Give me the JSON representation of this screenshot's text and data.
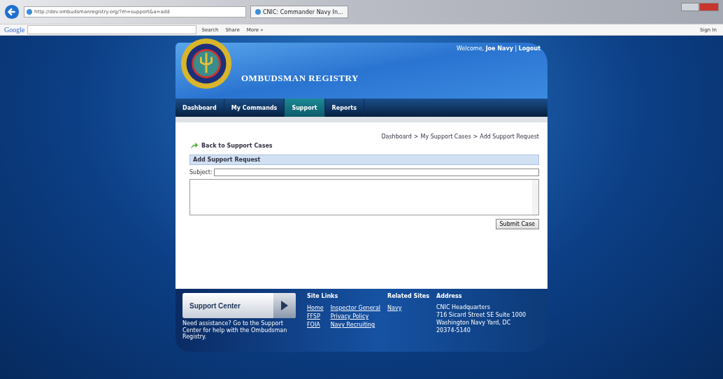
{
  "browser": {
    "url": "http://dev.ombudsmanregistry.org/?m=support&a=add",
    "tab_title": "CNIC: Commander Navy In...",
    "toolbar": {
      "brand": "Google",
      "buttons": [
        "Search",
        "Share",
        "More »"
      ],
      "sign_in": "Sign In"
    }
  },
  "header": {
    "title": "OMBUDSMAN REGISTRY",
    "welcome": "Welcome,",
    "user": "Joe Navy",
    "separator": "|",
    "logout": "Logout"
  },
  "nav": [
    {
      "label": "Dashboard",
      "selected": false
    },
    {
      "label": "My Commands",
      "selected": false
    },
    {
      "label": "Support",
      "selected": true
    },
    {
      "label": "Reports",
      "selected": false
    }
  ],
  "breadcrumb": {
    "separator": ">",
    "items": [
      "Dashboard",
      "My Support Cases",
      "Add Support Request"
    ]
  },
  "back_link": "Back to Support Cases",
  "form": {
    "heading": "Add Support Request",
    "subject_label": "Subject:",
    "submit": "Submit Case"
  },
  "footer": {
    "support_center": "Support Center",
    "support_text": "Need assistance? Go to the Support Center for help with the Ombudsman Registry.",
    "site_links_title": "Site Links",
    "site_links": [
      "Home",
      "Inspector General",
      "FFSP",
      "Privacy Policy",
      "FOIA",
      "Navy Recruiting"
    ],
    "related_title": "Related Sites",
    "related": [
      "Navy"
    ],
    "address_title": "Address",
    "address": [
      "CNIC Headquarters",
      "716 Sicard Street SE Suite 1000",
      "Washington Navy Yard, DC",
      "20374-5140"
    ]
  }
}
